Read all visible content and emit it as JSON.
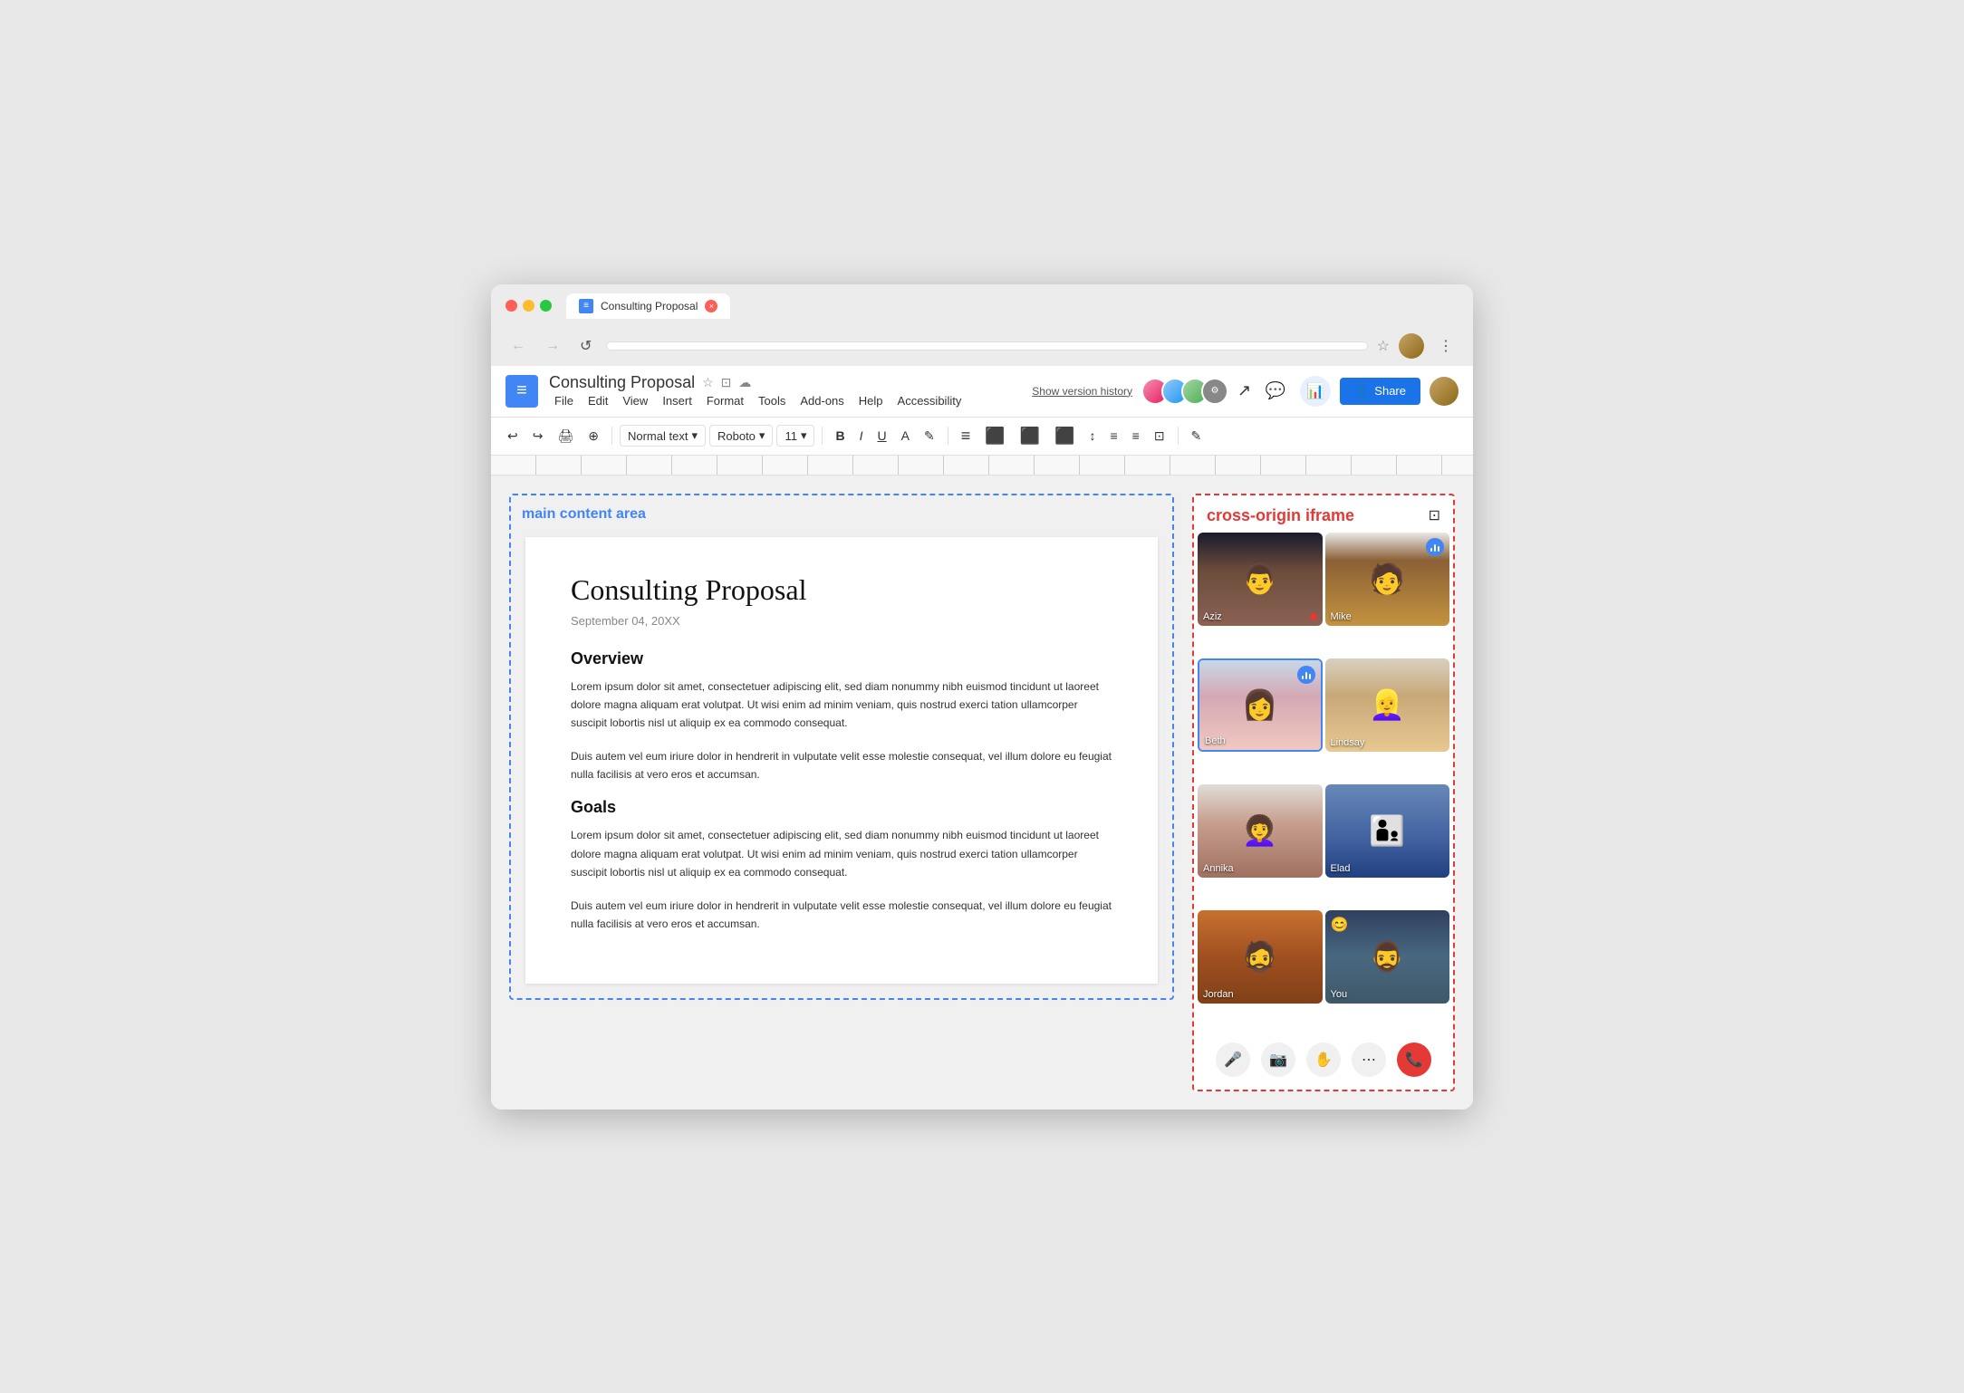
{
  "browser": {
    "tab_title": "Consulting Proposal",
    "tab_close_label": "×"
  },
  "nav": {
    "back_label": "←",
    "forward_label": "→",
    "refresh_label": "↺",
    "address": "",
    "menu_label": "⋮"
  },
  "docs": {
    "icon_label": "≡",
    "title": "Consulting Proposal",
    "star_icon": "☆",
    "folder_icon": "⊡",
    "cloud_icon": "☁",
    "menu_items": [
      "File",
      "Edit",
      "View",
      "Insert",
      "Format",
      "Tools",
      "Add-ons",
      "Help",
      "Accessibility"
    ],
    "version_history": "Show version history",
    "share_label": "Share",
    "share_icon": "👤"
  },
  "toolbar": {
    "undo_label": "↩",
    "redo_label": "↪",
    "print_label": "🖨",
    "zoom_label": "⊕",
    "style_label": "Normal text",
    "font_label": "Roboto",
    "size_label": "11",
    "bold_label": "B",
    "italic_label": "I",
    "underline_label": "U",
    "text_color_label": "A",
    "highlight_label": "✎",
    "align_left": "≡",
    "align_center": "≡",
    "align_right": "≡",
    "align_justify": "≡",
    "line_spacing": "↕",
    "bullet_list": "≡",
    "numbered_list": "≡",
    "image_label": "⊡",
    "more_label": "✎"
  },
  "doc_content": {
    "label": "main content area",
    "title": "Consulting Proposal",
    "date": "September 04, 20XX",
    "section1_heading": "Overview",
    "section1_para1": "Lorem ipsum dolor sit amet, consectetuer adipiscing elit, sed diam nonummy nibh euismod tincidunt ut laoreet dolore magna aliquam erat volutpat. Ut wisi enim ad minim veniam, quis nostrud exerci tation ullamcorper suscipit lobortis nisl ut aliquip ex ea commodo consequat.",
    "section1_para2": "Duis autem vel eum iriure dolor in hendrerit in vulputate velit esse molestie consequat, vel illum dolore eu feugiat nulla facilisis at vero eros et accumsan.",
    "section2_heading": "Goals",
    "section2_para1": "Lorem ipsum dolor sit amet, consectetuer adipiscing elit, sed diam nonummy nibh euismod tincidunt ut laoreet dolore magna aliquam erat volutpat. Ut wisi enim ad minim veniam, quis nostrud exerci tation ullamcorper suscipit lobortis nisl ut aliquip ex ea commodo consequat.",
    "section2_para2": "Duis autem vel eum iriure dolor in hendrerit in vulputate velit esse molestie consequat, vel illum dolore eu feugiat nulla facilisis at vero eros et accumsan."
  },
  "sidebar": {
    "title": "cross-origin iframe",
    "expand_icon": "⊡",
    "participants": [
      {
        "name": "Aziz",
        "face_class": "face-aziz",
        "has_red_dot": true
      },
      {
        "name": "Mike",
        "face_class": "face-mike",
        "has_audio_badge": true
      },
      {
        "name": "Beth",
        "face_class": "face-beth",
        "is_active": true,
        "has_audio_badge": true
      },
      {
        "name": "Lindsay",
        "face_class": "face-lindsay"
      },
      {
        "name": "Annika",
        "face_class": "face-annika"
      },
      {
        "name": "Elad",
        "face_class": "face-elad"
      },
      {
        "name": "Jordan",
        "face_class": "face-jordan"
      },
      {
        "name": "You",
        "face_class": "face-you",
        "has_emoji": "😊"
      }
    ],
    "controls": {
      "mic_icon": "🎤",
      "camera_icon": "📷",
      "hand_icon": "✋",
      "more_icon": "⋯",
      "end_call_icon": "📞"
    }
  }
}
